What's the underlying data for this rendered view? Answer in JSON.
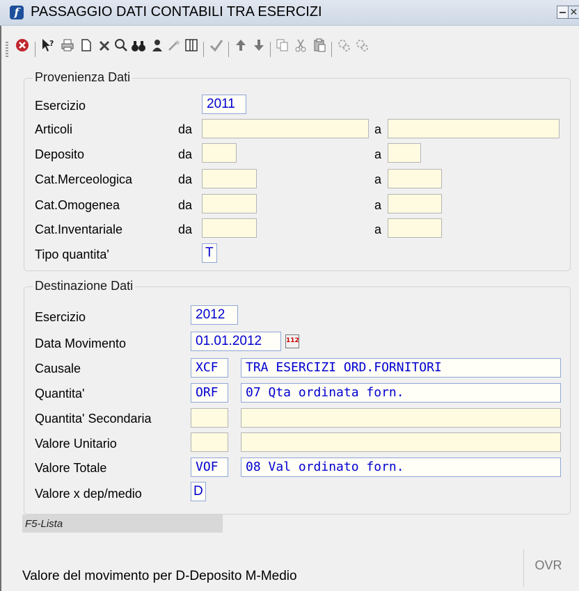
{
  "window": {
    "title": "PASSAGGIO DATI CONTABILI TRA ESERCIZI",
    "close_glyph": "✕"
  },
  "toolbar": {
    "icons": [
      "close-red-icon",
      "help-icon",
      "print-icon",
      "new-icon",
      "delete-icon",
      "search-icon",
      "binoculars-icon",
      "user-icon",
      "wand-icon",
      "columns-icon",
      "confirm-icon",
      "arrow-up-icon",
      "arrow-down-icon",
      "copy-icon",
      "cut-icon",
      "paste-icon",
      "run-icon",
      "run-all-icon"
    ]
  },
  "provenienza": {
    "legend": "Provenienza Dati",
    "esercizio_label": "Esercizio",
    "esercizio_value": "2011",
    "da": "da",
    "a": "a",
    "rows": [
      {
        "label": "Articoli"
      },
      {
        "label": "Deposito"
      },
      {
        "label": "Cat.Merceologica"
      },
      {
        "label": "Cat.Omogenea"
      },
      {
        "label": "Cat.Inventariale"
      }
    ],
    "tipo_label": "Tipo quantita'",
    "tipo_value": "T"
  },
  "destinazione": {
    "legend": "Destinazione Dati",
    "esercizio_label": "Esercizio",
    "esercizio_value": "2012",
    "data_label": "Data Movimento",
    "data_value": "01.01.2012",
    "causale_label": "Causale",
    "causale_code": "XCF",
    "causale_desc": "TRA ESERCIZI ORD.FORNITORI",
    "quantita_label": "Quantita'",
    "quantita_code": "ORF",
    "quantita_desc": "07 Qta ordinata forn.",
    "quantita_sec_label": "Quantita' Secondaria",
    "quantita_sec_code": "",
    "quantita_sec_desc": "",
    "valore_unit_label": "Valore Unitario",
    "valore_unit_code": "",
    "valore_unit_desc": "",
    "valore_tot_label": "Valore Totale",
    "valore_tot_code": "VOF",
    "valore_tot_desc": "08 Val ordinato forn.",
    "valore_dep_label": "Valore x dep/medio",
    "valore_dep_value": "D"
  },
  "hint": "F5-Lista",
  "status": {
    "message": "Valore del movimento per D-Deposito M-Medio",
    "mode": "OVR"
  }
}
